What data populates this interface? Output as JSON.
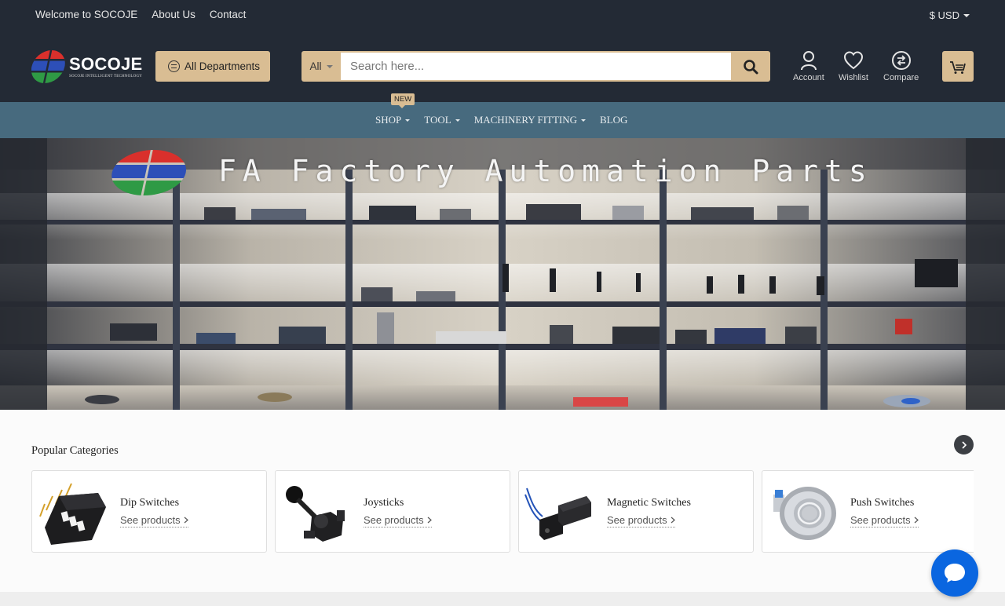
{
  "topbar": {
    "links": [
      "Welcome to SOCOJE",
      "About Us",
      "Contact"
    ],
    "currency": "$ USD"
  },
  "header": {
    "brand": "SOCOJE",
    "tagline": "SOCOJE INTELLIGENT TECHNOLOGY",
    "departments_label": "All Departments",
    "search": {
      "category": "All",
      "placeholder": "Search here...",
      "value": ""
    },
    "icons": {
      "account": "Account",
      "wishlist": "Wishlist",
      "compare": "Compare"
    }
  },
  "nav": {
    "items": [
      {
        "label": "SHOP",
        "badge": "NEW",
        "dropdown": true
      },
      {
        "label": "TOOL",
        "dropdown": true
      },
      {
        "label": "MACHINERY FITTING",
        "dropdown": true
      },
      {
        "label": "BLOG",
        "dropdown": false
      }
    ]
  },
  "hero": {
    "title": "FA Factory Automation Parts"
  },
  "popular": {
    "title": "Popular Categories",
    "categories": [
      {
        "name": "Dip Switches",
        "link": "See products"
      },
      {
        "name": "Joysticks",
        "link": "See products"
      },
      {
        "name": "Magnetic Switches",
        "link": "See products"
      },
      {
        "name": "Push Switches",
        "link": "See products"
      }
    ]
  },
  "colors": {
    "header_bg": "#232a35",
    "accent": "#d9bd93",
    "nav_bg": "#476a7e",
    "chat": "#0a66e0"
  }
}
